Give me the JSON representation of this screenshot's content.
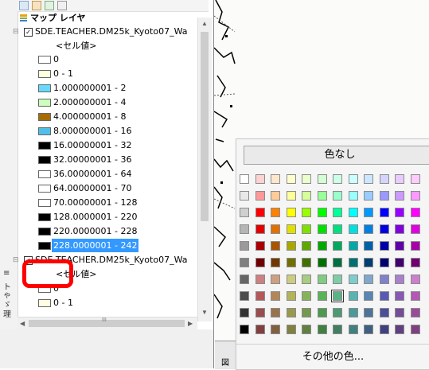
{
  "toc": {
    "root_label": "マップ レイヤ",
    "layers": [
      {
        "name": "SDE.TEACHER.DM25k_Kyoto07_Wa",
        "checked": true,
        "field_label": "<セル値>",
        "classes": [
          {
            "label": "0",
            "color": "#ffffff"
          },
          {
            "label": "0 - 1",
            "color": "#ffffe0"
          },
          {
            "label": "1.000000001 - 2",
            "color": "#66d9ff"
          },
          {
            "label": "2.000000001 - 4",
            "color": "#ccffbb"
          },
          {
            "label": "4.000000001 - 8",
            "color": "#a86c00"
          },
          {
            "label": "8.000000001 - 16",
            "color": "#4ec0e8"
          },
          {
            "label": "16.00000001 - 32",
            "color": "#000000"
          },
          {
            "label": "32.00000001 - 36",
            "color": "#000000"
          },
          {
            "label": "36.00000001 - 64",
            "color": "#ffffff"
          },
          {
            "label": "64.00000001 - 70",
            "color": "#ffffff"
          },
          {
            "label": "70.00000001 - 128",
            "color": "#ffffff"
          },
          {
            "label": "128.0000001 - 220",
            "color": "#000000"
          },
          {
            "label": "220.0000001 - 228",
            "color": "#000000"
          },
          {
            "label": "228.0000001 - 242",
            "color": "#000000",
            "selected": true
          }
        ]
      },
      {
        "name": "SDE.TEACHER.DM25k_Kyoto07_Wa",
        "checked": true,
        "field_label": "<セル値>",
        "classes": [
          {
            "label": "0",
            "color": "#ffffff"
          },
          {
            "label": "0 - 1",
            "color": "#ffffe0"
          }
        ]
      }
    ],
    "scroll_glyphs": {
      "up": "▲",
      "down": "▼",
      "left": "◀",
      "right": "▶",
      "grip": "III"
    },
    "left_edge_chars": [
      "≡",
      "ト",
      "ゃ",
      "ゞ",
      "理"
    ]
  },
  "palette": {
    "no_color_label": "色なし",
    "more_colors_label": "その他の色...",
    "selected_index": 90,
    "rows": [
      [
        "#ffffff",
        "#ffd2d2",
        "#ffe7cc",
        "#ffffcc",
        "#e9ffcc",
        "#d4ffd4",
        "#ccffe7",
        "#ccffff",
        "#cce7ff",
        "#d4d4ff",
        "#e9ccff",
        "#ffccff"
      ],
      [
        "#e8e8e8",
        "#ff9999",
        "#ffcc99",
        "#ffff99",
        "#d4ff99",
        "#99ff99",
        "#99ffcc",
        "#99ffff",
        "#99ccff",
        "#9999ff",
        "#cc99ff",
        "#ff99ff"
      ],
      [
        "#cfcfcf",
        "#ff0000",
        "#ff8000",
        "#ffff00",
        "#99ff00",
        "#00ff00",
        "#00ff99",
        "#00ffff",
        "#0099ff",
        "#0000ff",
        "#9900ff",
        "#ff00ff"
      ],
      [
        "#b5b5b5",
        "#e00000",
        "#e07000",
        "#e0e000",
        "#80e000",
        "#00e000",
        "#00e080",
        "#00e0e0",
        "#0080e0",
        "#0000e0",
        "#8000e0",
        "#e000e0"
      ],
      [
        "#9a9a9a",
        "#a80000",
        "#a85400",
        "#a8a800",
        "#60a800",
        "#00a800",
        "#00a860",
        "#00a8a8",
        "#0060a8",
        "#0000a8",
        "#6000a8",
        "#a800a8"
      ],
      [
        "#808080",
        "#700000",
        "#703800",
        "#707000",
        "#407000",
        "#007000",
        "#007040",
        "#007070",
        "#004070",
        "#000070",
        "#400070",
        "#700070"
      ],
      [
        "#666666",
        "#cc8080",
        "#cca080",
        "#cccc80",
        "#a8cc80",
        "#80cc80",
        "#80cca8",
        "#80cccc",
        "#80a8cc",
        "#8080cc",
        "#a880cc",
        "#cc80cc"
      ],
      [
        "#4d4d4d",
        "#b35959",
        "#b38659",
        "#b3b359",
        "#86b359",
        "#59b359",
        "#59b386",
        "#59b3b3",
        "#5986b3",
        "#5959b3",
        "#8659b3",
        "#b359b3"
      ],
      [
        "#333333",
        "#994d4d",
        "#99734d",
        "#99994d",
        "#73994d",
        "#4d994d",
        "#4d9973",
        "#4d9999",
        "#4d7399",
        "#4d4d99",
        "#734d99",
        "#994d99"
      ],
      [
        "#000000",
        "#804040",
        "#806040",
        "#808040",
        "#608040",
        "#408040",
        "#408060",
        "#408080",
        "#406080",
        "#404080",
        "#604080",
        "#804080"
      ]
    ]
  },
  "map_bottom_label": "図"
}
